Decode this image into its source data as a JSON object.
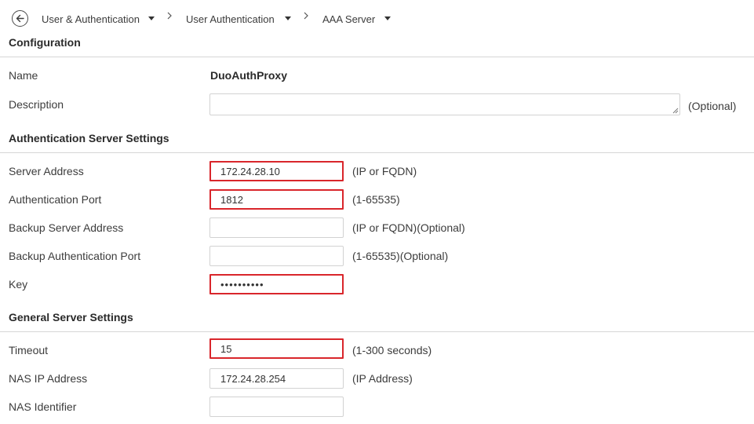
{
  "breadcrumb": {
    "items": [
      {
        "label": "User & Authentication"
      },
      {
        "label": "User Authentication"
      },
      {
        "label": "AAA Server"
      }
    ]
  },
  "configuration": {
    "title": "Configuration",
    "name_label": "Name",
    "name_value": "DuoAuthProxy",
    "description_label": "Description",
    "description_value": "",
    "description_hint": "(Optional)"
  },
  "auth_server": {
    "title": "Authentication Server Settings",
    "server_address_label": "Server Address",
    "server_address_value": "172.24.28.10",
    "server_address_hint": "(IP or FQDN)",
    "auth_port_label": "Authentication Port",
    "auth_port_value": "1812",
    "auth_port_hint": "(1-65535)",
    "backup_address_label": "Backup Server Address",
    "backup_address_value": "",
    "backup_address_hint": "(IP or FQDN)(Optional)",
    "backup_port_label": "Backup Authentication Port",
    "backup_port_value": "",
    "backup_port_hint": "(1-65535)(Optional)",
    "key_label": "Key",
    "key_value": "••••••••••"
  },
  "general": {
    "title": "General Server Settings",
    "timeout_label": "Timeout",
    "timeout_value": "15",
    "timeout_hint": "(1-300 seconds)",
    "nas_ip_label": "NAS IP Address",
    "nas_ip_value": "172.24.28.254",
    "nas_ip_hint": "(IP Address)",
    "nas_id_label": "NAS Identifier",
    "nas_id_value": ""
  },
  "colors": {
    "highlight": "#d9262b",
    "divider": "#d6d6d6"
  },
  "icons": {
    "back": "back-arrow-icon",
    "dropdown": "caret-down-icon",
    "separator": "chevron-right-icon"
  }
}
